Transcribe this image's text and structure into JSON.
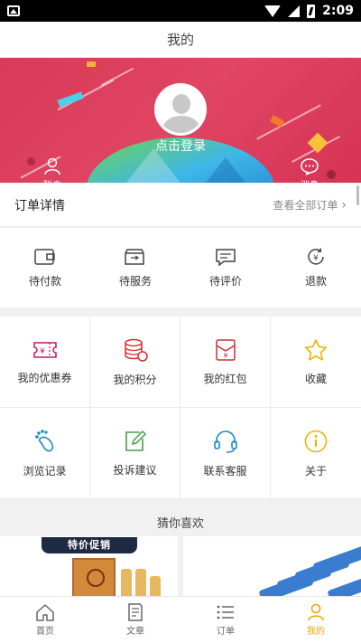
{
  "status_bar": {
    "time": "2:09"
  },
  "header": {
    "title": "我的"
  },
  "banner": {
    "login_label": "点击登录",
    "account_label": "账户",
    "message_label": "消息"
  },
  "orders": {
    "title": "订单详情",
    "view_all_label": "查看全部订单",
    "items": [
      {
        "label": "待付款",
        "icon": "wallet-icon"
      },
      {
        "label": "待服务",
        "icon": "service-box-icon"
      },
      {
        "label": "待评价",
        "icon": "comment-icon"
      },
      {
        "label": "退款",
        "icon": "refund-icon"
      }
    ]
  },
  "services": {
    "items": [
      {
        "label": "我的优惠券",
        "icon": "coupon-icon",
        "color": "#c2185b"
      },
      {
        "label": "我的积分",
        "icon": "points-coins-icon",
        "color": "#d32f2f"
      },
      {
        "label": "我的红包",
        "icon": "red-envelope-icon",
        "color": "#d32f2f"
      },
      {
        "label": "收藏",
        "icon": "star-icon",
        "color": "#f0b400"
      },
      {
        "label": "浏览记录",
        "icon": "footprint-icon",
        "color": "#1e88c7"
      },
      {
        "label": "投诉建议",
        "icon": "edit-icon",
        "color": "#43a047"
      },
      {
        "label": "联系客服",
        "icon": "headset-icon",
        "color": "#1e88c7"
      },
      {
        "label": "关于",
        "icon": "info-icon",
        "color": "#f0b400"
      }
    ]
  },
  "recommend": {
    "title": "猜你喜欢",
    "products": [
      {
        "promo_label": "特价促销"
      },
      {
        "promo_label": ""
      }
    ]
  },
  "tabs": [
    {
      "label": "首页",
      "icon": "home-icon",
      "active": false
    },
    {
      "label": "文章",
      "icon": "article-icon",
      "active": false
    },
    {
      "label": "订单",
      "icon": "list-icon",
      "active": false
    },
    {
      "label": "我的",
      "icon": "user-icon",
      "active": true
    }
  ],
  "colors": {
    "accent": "#f0a500",
    "banner": "#dc3e5c"
  }
}
